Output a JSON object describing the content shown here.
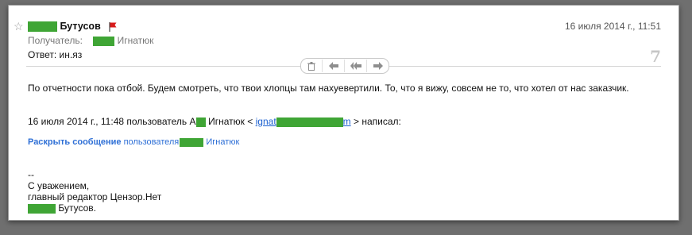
{
  "message": {
    "sender_name": "Бутусов",
    "date": "16 июля 2014 г., 11:51",
    "recipient_label": "Получатель:",
    "recipient_name": "Игнатюк",
    "subject_label": "Ответ:",
    "subject_value": "ин.яз",
    "thread_count": "7",
    "body_text": "По отчетности пока отбой. Будем смотреть, что твои хлопцы там нахуевертили. То, что я вижу, совсем не то, что хотел от нас заказчик.",
    "quote_header": {
      "prefix": "16 июля 2014 г., 11:48 пользователь А",
      "suffix_name": "Игнатюк <",
      "email_start": "ignat",
      "email_end": "m",
      "wrote": "> написал:"
    },
    "expand": {
      "link_bold": "Раскрыть сообщение",
      "link_rest": "пользователя",
      "link_name": "Игнатюк"
    },
    "signature": {
      "dash": "--",
      "line1": "С уважением,",
      "line2": "главный редактор Цензор.Нет",
      "line3": "Бутусов."
    }
  },
  "toolbar": {
    "delete_icon": "trash-icon",
    "reply_icon": "reply-icon",
    "reply_all_icon": "reply-all-icon",
    "forward_icon": "forward-icon"
  },
  "colors": {
    "redaction": "#3fa535",
    "flag": "#d81b1b",
    "link": "#2e6fd6",
    "background": "#6f6f6f"
  }
}
